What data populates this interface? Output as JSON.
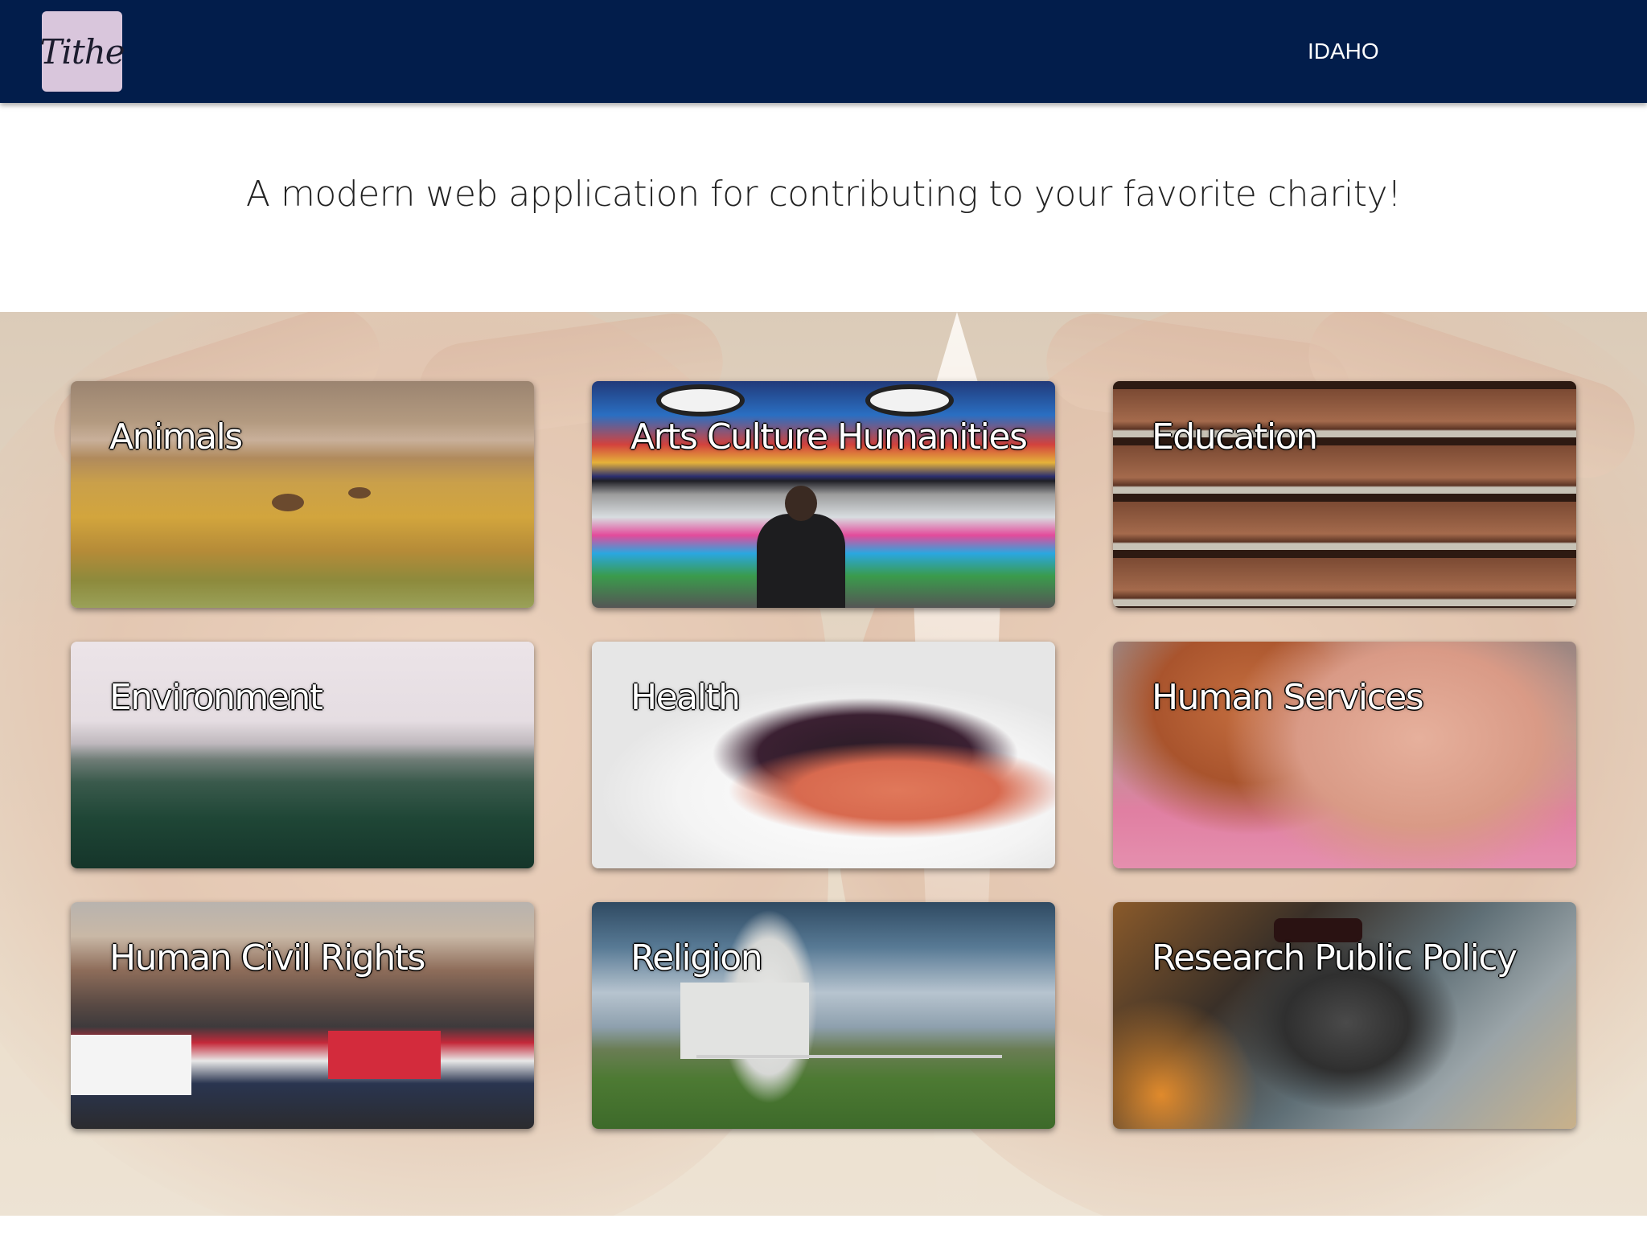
{
  "header": {
    "logo_text": "Tithe",
    "state_label": "IDAHO",
    "background_color": "#021d4b"
  },
  "tagline": "A modern web application for contributing to your favorite charity!",
  "categories": [
    {
      "label": "Animals"
    },
    {
      "label": "Arts Culture Humanities"
    },
    {
      "label": "Education"
    },
    {
      "label": "Environment"
    },
    {
      "label": "Health"
    },
    {
      "label": "Human Services"
    },
    {
      "label": "Human Civil Rights"
    },
    {
      "label": "Religion"
    },
    {
      "label": "Research Public Policy"
    }
  ]
}
